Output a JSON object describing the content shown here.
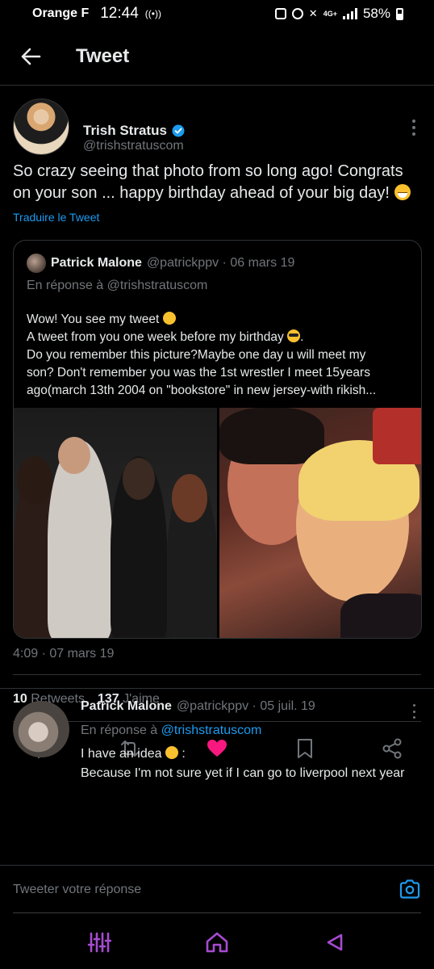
{
  "status_bar": {
    "carrier": "Orange F",
    "time": "12:44",
    "network": "4G+",
    "battery": "58%"
  },
  "header": {
    "title": "Tweet"
  },
  "main_tweet": {
    "author_name": "Trish Stratus",
    "author_handle": "@trishstratuscom",
    "text": "So crazy seeing that photo from so long ago! Congrats on your son ...  happy birthday ahead of your big day! ",
    "translate_label": "Traduire le Tweet",
    "timestamp": "4:09 · 07 mars 19",
    "retweets_count": "10",
    "retweets_label": "Retweets",
    "likes_count": "137",
    "likes_label": "J'aime",
    "liked": true,
    "like_color": "#f91880"
  },
  "quoted_tweet": {
    "author_name": "Patrick Malone",
    "meta": "@patrickppv · 06 mars 19",
    "reply_to": "En réponse à @trishstratuscom",
    "lines": [
      "Wow! You see my tweet ",
      "A tweet from you one week before my birthday ",
      "Do you remember this picture?Maybe one day u will meet my",
      "son? Don't remember you was the 1st wrestler I meet 15years",
      "ago(march 13th 2004 on \"bookstore\" in new jersey-with rikish..."
    ],
    "line_end_1": "",
    "line_end_2": "."
  },
  "reply_tweet": {
    "author_name": "Patrick Malone",
    "meta": "@patrickppv · 05 juil. 19",
    "reply_prefix": "En réponse à",
    "reply_handle": "@trishstratuscom",
    "line1": "I have an idea ",
    "line1_end": ":",
    "line2": "Because I'm not sure yet if I can go to liverpool next year"
  },
  "composer": {
    "placeholder": "Tweeter votre réponse"
  },
  "colors": {
    "accent": "#1d9bf0",
    "secondary_text": "#71767b",
    "nav_icon": "#a64bd0"
  },
  "icons": {
    "back": "arrow-left-icon",
    "verified": "verified-badge-icon",
    "reply": "reply-icon",
    "retweet": "retweet-icon",
    "like": "heart-icon",
    "bookmark": "bookmark-icon",
    "share": "share-icon",
    "camera": "camera-icon"
  }
}
